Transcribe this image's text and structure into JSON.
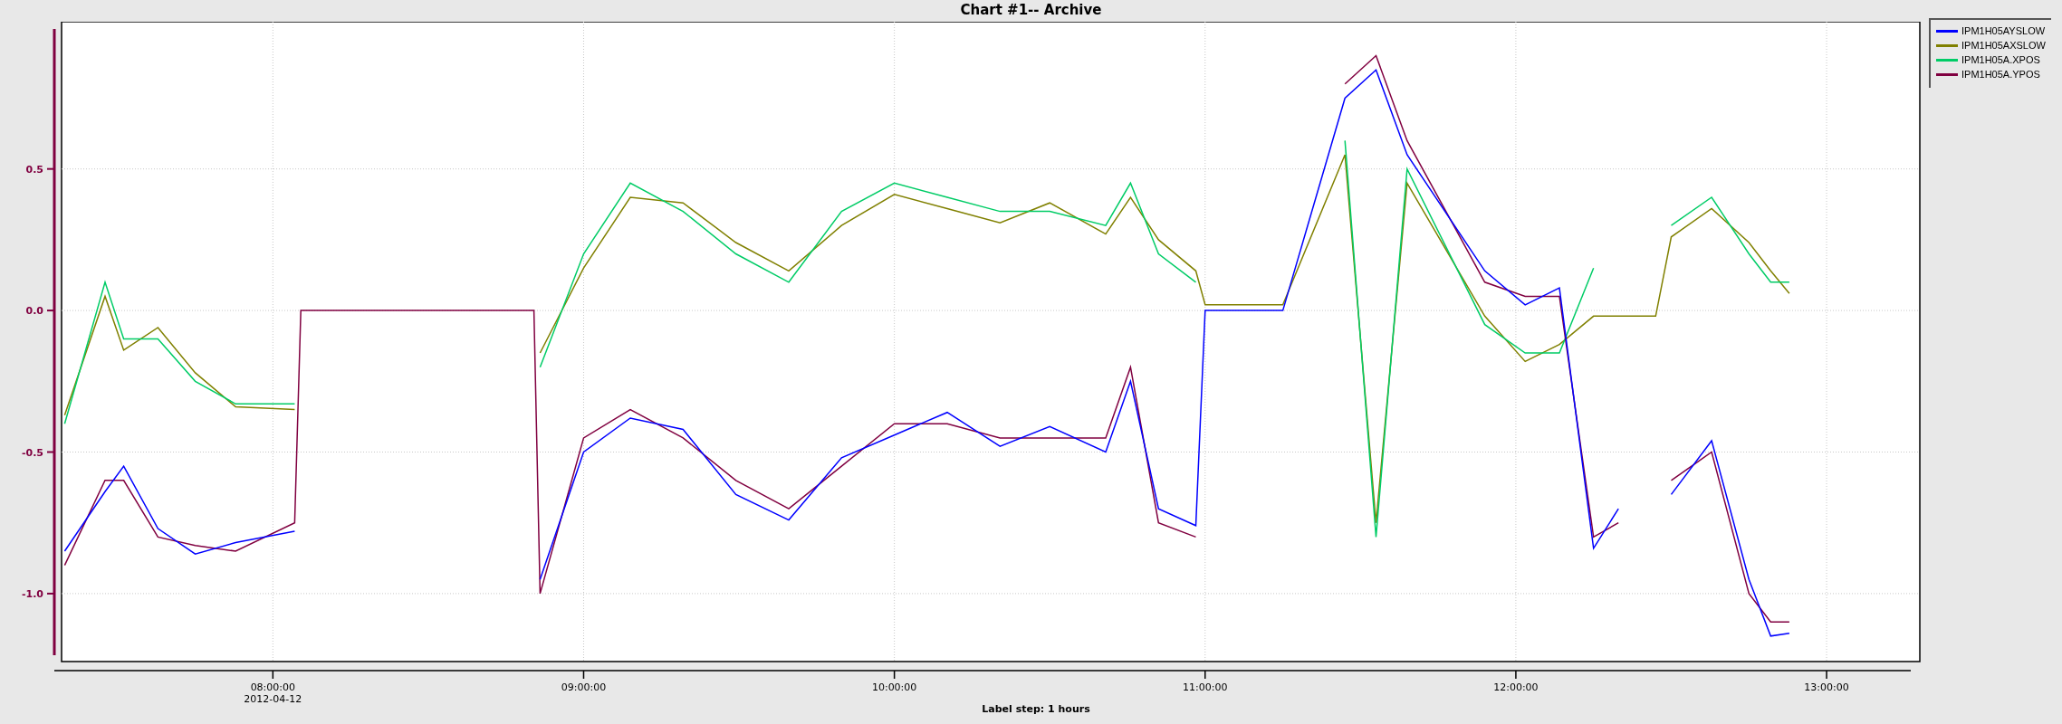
{
  "chart": {
    "date_label": "2012-04-12",
    "chart_data": {
      "type": "line",
      "title": "Chart #1-- Archive",
      "xlabel": "Label step: 1 hours",
      "grid": true,
      "xlim": [
        7.32,
        13.3
      ],
      "ylim": [
        -1.24,
        1.02
      ],
      "xticks": [
        {
          "value": 8,
          "label": "08:00:00"
        },
        {
          "value": 9,
          "label": "09:00:00"
        },
        {
          "value": 10,
          "label": "10:00:00"
        },
        {
          "value": 11,
          "label": "11:00:00"
        },
        {
          "value": 12,
          "label": "12:00:00"
        },
        {
          "value": 13,
          "label": "13:00:00"
        }
      ],
      "yticks": [
        {
          "value": -1,
          "label": "-1.0"
        },
        {
          "value": -0.5,
          "label": "-0.5"
        },
        {
          "value": 0,
          "label": "0.0"
        },
        {
          "value": 0.5,
          "label": "0.5"
        }
      ],
      "x": [
        7.33,
        7.46,
        7.52,
        7.63,
        7.75,
        7.88,
        8.07,
        8.09,
        8.5,
        8.84,
        8.86,
        9.0,
        9.15,
        9.32,
        9.49,
        9.66,
        9.83,
        10.0,
        10.17,
        10.34,
        10.5,
        10.68,
        10.76,
        10.85,
        10.97,
        11.0,
        11.25,
        11.45,
        11.55,
        11.65,
        11.9,
        12.03,
        12.14,
        12.25,
        12.33,
        12.45,
        12.5,
        12.63,
        12.75,
        12.82,
        12.88
      ],
      "series": [
        {
          "name": "IPM1H05AYSLOW",
          "color": "#0000ff",
          "values": [
            -0.85,
            -0.64,
            -0.55,
            -0.77,
            -0.86,
            -0.82,
            -0.78,
            null,
            null,
            null,
            -0.95,
            -0.5,
            -0.38,
            -0.42,
            -0.65,
            -0.74,
            -0.52,
            -0.44,
            -0.36,
            -0.48,
            -0.41,
            -0.5,
            -0.25,
            -0.7,
            -0.76,
            0,
            0,
            0.75,
            0.85,
            0.55,
            0.14,
            0.02,
            0.08,
            -0.84,
            -0.7,
            null,
            -0.65,
            -0.46,
            -0.95,
            -1.15,
            -1.14
          ]
        },
        {
          "name": "IPM1H05AXSLOW",
          "color": "#808000",
          "values": [
            -0.37,
            0.05,
            -0.14,
            -0.06,
            -0.22,
            -0.34,
            -0.35,
            null,
            null,
            null,
            -0.15,
            0.15,
            0.4,
            0.38,
            0.24,
            0.14,
            0.3,
            0.41,
            0.36,
            0.31,
            0.38,
            0.27,
            0.4,
            0.25,
            0.14,
            0.02,
            0.02,
            0.55,
            -0.75,
            0.45,
            -0.02,
            -0.18,
            -0.12,
            -0.02,
            -0.02,
            -0.02,
            0.26,
            0.36,
            0.24,
            0.14,
            0.06
          ]
        },
        {
          "name": "IPM1H05A.XPOS",
          "color": "#00cc66",
          "values": [
            -0.4,
            0.1,
            -0.1,
            -0.1,
            -0.25,
            -0.33,
            -0.33,
            null,
            null,
            null,
            -0.2,
            0.2,
            0.45,
            0.35,
            0.2,
            0.1,
            0.35,
            0.45,
            0.4,
            0.35,
            0.35,
            0.3,
            0.45,
            0.2,
            0.1,
            null,
            null,
            0.6,
            -0.8,
            0.5,
            -0.05,
            -0.15,
            -0.15,
            0.15,
            null,
            null,
            0.3,
            0.4,
            0.2,
            0.1,
            0.1
          ]
        },
        {
          "name": "IPM1H05A.YPOS",
          "color": "#800040",
          "values": [
            -0.9,
            -0.6,
            -0.6,
            -0.8,
            -0.83,
            -0.85,
            -0.75,
            0,
            0,
            0,
            -1.0,
            -0.45,
            -0.35,
            -0.45,
            -0.6,
            -0.7,
            -0.55,
            -0.4,
            -0.4,
            -0.45,
            -0.45,
            -0.45,
            -0.2,
            -0.75,
            -0.8,
            null,
            null,
            0.8,
            0.9,
            0.6,
            0.1,
            0.05,
            0.05,
            -0.8,
            -0.75,
            null,
            -0.6,
            -0.5,
            -1.0,
            -1.1,
            -1.1
          ]
        }
      ]
    }
  }
}
